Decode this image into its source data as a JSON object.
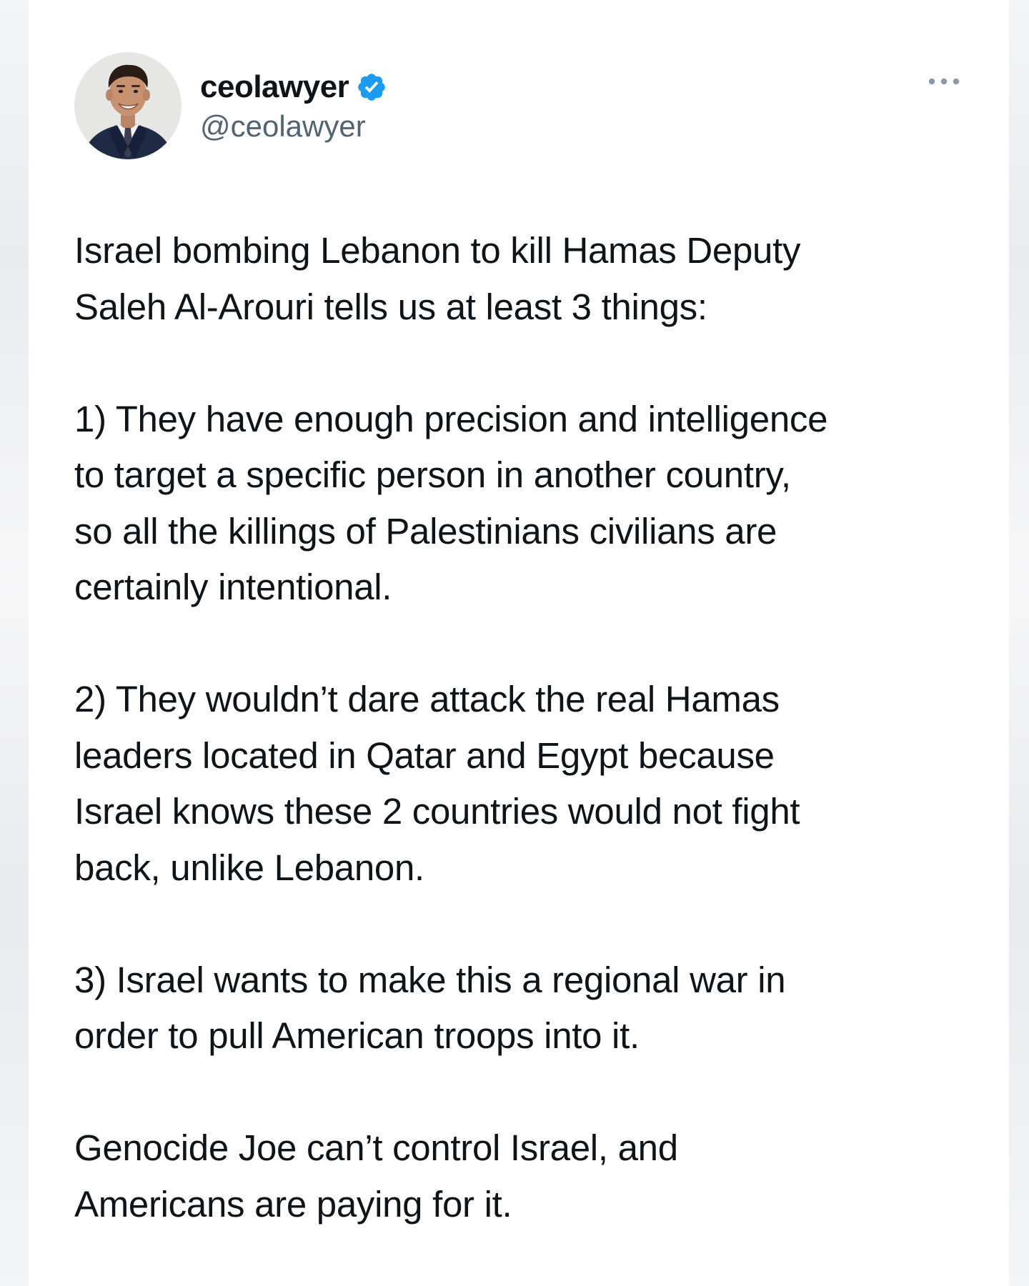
{
  "author": {
    "display_name": "ceolawyer",
    "handle": "@ceolawyer",
    "verified": true,
    "avatar_icon": "profile-photo-man-in-suit"
  },
  "menu": {
    "icon": "more-dots-icon"
  },
  "tweet": {
    "paragraphs": [
      "Israel bombing Lebanon to kill Hamas Deputy\nSaleh Al-Arouri tells us at least 3 things:",
      "1) They have enough precision and intelligence\nto target a specific person in another country,\nso all the killings of Palestinians civilians are\ncertainly intentional.",
      "2) They wouldn’t dare attack the real Hamas\nleaders located in Qatar and Egypt because\nIsrael knows these 2 countries would not fight\nback, unlike Lebanon.",
      "3) Israel wants to make this a regional war in\norder to pull American troops into it.",
      "Genocide Joe can’t control Israel, and\nAmericans are paying for it."
    ]
  },
  "colors": {
    "text_primary": "#0f1419",
    "text_secondary": "#536471",
    "verified_blue": "#1d9bf0",
    "card_background": "#ffffff"
  }
}
